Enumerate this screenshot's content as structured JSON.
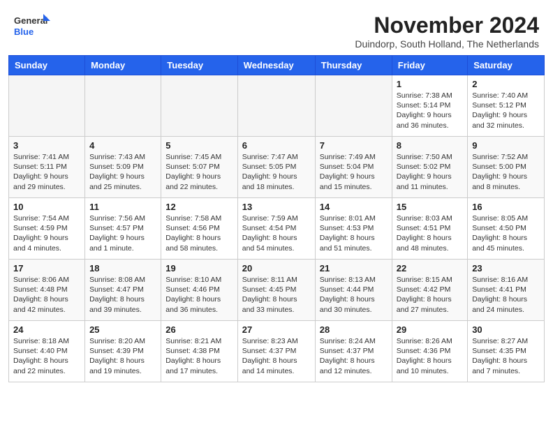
{
  "header": {
    "logo_line1": "General",
    "logo_line2": "Blue",
    "month_title": "November 2024",
    "subtitle": "Duindorp, South Holland, The Netherlands"
  },
  "days_of_week": [
    "Sunday",
    "Monday",
    "Tuesday",
    "Wednesday",
    "Thursday",
    "Friday",
    "Saturday"
  ],
  "weeks": [
    [
      {
        "day": "",
        "info": ""
      },
      {
        "day": "",
        "info": ""
      },
      {
        "day": "",
        "info": ""
      },
      {
        "day": "",
        "info": ""
      },
      {
        "day": "",
        "info": ""
      },
      {
        "day": "1",
        "info": "Sunrise: 7:38 AM\nSunset: 5:14 PM\nDaylight: 9 hours and 36 minutes."
      },
      {
        "day": "2",
        "info": "Sunrise: 7:40 AM\nSunset: 5:12 PM\nDaylight: 9 hours and 32 minutes."
      }
    ],
    [
      {
        "day": "3",
        "info": "Sunrise: 7:41 AM\nSunset: 5:11 PM\nDaylight: 9 hours and 29 minutes."
      },
      {
        "day": "4",
        "info": "Sunrise: 7:43 AM\nSunset: 5:09 PM\nDaylight: 9 hours and 25 minutes."
      },
      {
        "day": "5",
        "info": "Sunrise: 7:45 AM\nSunset: 5:07 PM\nDaylight: 9 hours and 22 minutes."
      },
      {
        "day": "6",
        "info": "Sunrise: 7:47 AM\nSunset: 5:05 PM\nDaylight: 9 hours and 18 minutes."
      },
      {
        "day": "7",
        "info": "Sunrise: 7:49 AM\nSunset: 5:04 PM\nDaylight: 9 hours and 15 minutes."
      },
      {
        "day": "8",
        "info": "Sunrise: 7:50 AM\nSunset: 5:02 PM\nDaylight: 9 hours and 11 minutes."
      },
      {
        "day": "9",
        "info": "Sunrise: 7:52 AM\nSunset: 5:00 PM\nDaylight: 9 hours and 8 minutes."
      }
    ],
    [
      {
        "day": "10",
        "info": "Sunrise: 7:54 AM\nSunset: 4:59 PM\nDaylight: 9 hours and 4 minutes."
      },
      {
        "day": "11",
        "info": "Sunrise: 7:56 AM\nSunset: 4:57 PM\nDaylight: 9 hours and 1 minute."
      },
      {
        "day": "12",
        "info": "Sunrise: 7:58 AM\nSunset: 4:56 PM\nDaylight: 8 hours and 58 minutes."
      },
      {
        "day": "13",
        "info": "Sunrise: 7:59 AM\nSunset: 4:54 PM\nDaylight: 8 hours and 54 minutes."
      },
      {
        "day": "14",
        "info": "Sunrise: 8:01 AM\nSunset: 4:53 PM\nDaylight: 8 hours and 51 minutes."
      },
      {
        "day": "15",
        "info": "Sunrise: 8:03 AM\nSunset: 4:51 PM\nDaylight: 8 hours and 48 minutes."
      },
      {
        "day": "16",
        "info": "Sunrise: 8:05 AM\nSunset: 4:50 PM\nDaylight: 8 hours and 45 minutes."
      }
    ],
    [
      {
        "day": "17",
        "info": "Sunrise: 8:06 AM\nSunset: 4:48 PM\nDaylight: 8 hours and 42 minutes."
      },
      {
        "day": "18",
        "info": "Sunrise: 8:08 AM\nSunset: 4:47 PM\nDaylight: 8 hours and 39 minutes."
      },
      {
        "day": "19",
        "info": "Sunrise: 8:10 AM\nSunset: 4:46 PM\nDaylight: 8 hours and 36 minutes."
      },
      {
        "day": "20",
        "info": "Sunrise: 8:11 AM\nSunset: 4:45 PM\nDaylight: 8 hours and 33 minutes."
      },
      {
        "day": "21",
        "info": "Sunrise: 8:13 AM\nSunset: 4:44 PM\nDaylight: 8 hours and 30 minutes."
      },
      {
        "day": "22",
        "info": "Sunrise: 8:15 AM\nSunset: 4:42 PM\nDaylight: 8 hours and 27 minutes."
      },
      {
        "day": "23",
        "info": "Sunrise: 8:16 AM\nSunset: 4:41 PM\nDaylight: 8 hours and 24 minutes."
      }
    ],
    [
      {
        "day": "24",
        "info": "Sunrise: 8:18 AM\nSunset: 4:40 PM\nDaylight: 8 hours and 22 minutes."
      },
      {
        "day": "25",
        "info": "Sunrise: 8:20 AM\nSunset: 4:39 PM\nDaylight: 8 hours and 19 minutes."
      },
      {
        "day": "26",
        "info": "Sunrise: 8:21 AM\nSunset: 4:38 PM\nDaylight: 8 hours and 17 minutes."
      },
      {
        "day": "27",
        "info": "Sunrise: 8:23 AM\nSunset: 4:37 PM\nDaylight: 8 hours and 14 minutes."
      },
      {
        "day": "28",
        "info": "Sunrise: 8:24 AM\nSunset: 4:37 PM\nDaylight: 8 hours and 12 minutes."
      },
      {
        "day": "29",
        "info": "Sunrise: 8:26 AM\nSunset: 4:36 PM\nDaylight: 8 hours and 10 minutes."
      },
      {
        "day": "30",
        "info": "Sunrise: 8:27 AM\nSunset: 4:35 PM\nDaylight: 8 hours and 7 minutes."
      }
    ]
  ]
}
